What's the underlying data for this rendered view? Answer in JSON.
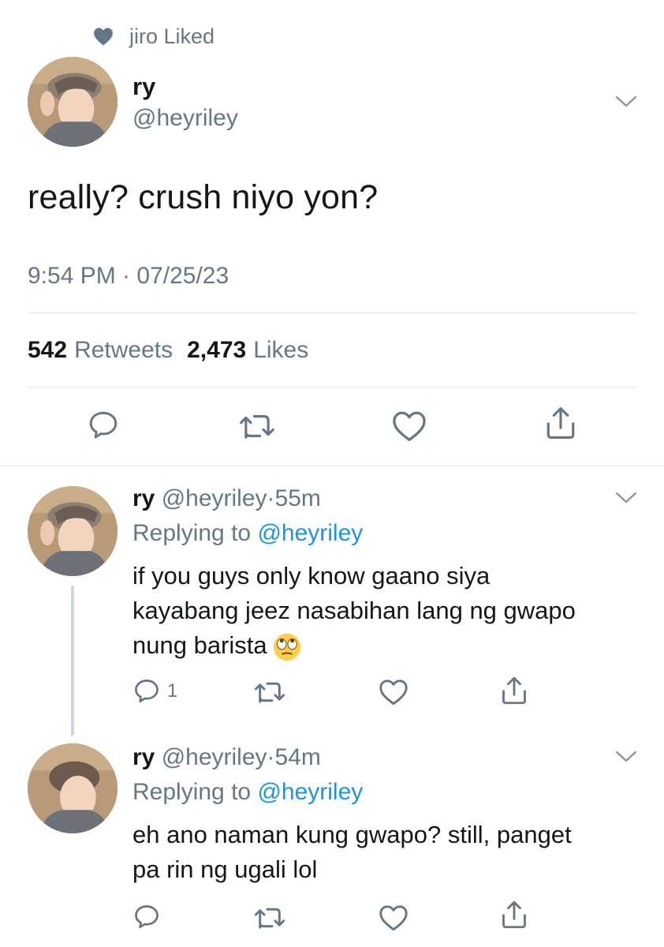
{
  "social_context": {
    "text": "jiro Liked",
    "icon": "heart-icon"
  },
  "main_tweet": {
    "name": "ry",
    "handle": "@heyriley",
    "text": "really? crush niyo yon?",
    "timestamp": "9:54 PM · 07/25/23",
    "retweets_count": "542",
    "retweets_label": "Retweets",
    "likes_count": "2,473",
    "likes_label": "Likes",
    "actions": [
      "reply-icon",
      "retweet-icon",
      "like-icon",
      "share-icon"
    ]
  },
  "replies": [
    {
      "name": "ry",
      "handle": "@heyriley",
      "separator": "·",
      "time": "55m",
      "replying_prefix": "Replying to",
      "replying_handle": "@heyriley",
      "lines": [
        "if you guys only know gaano siya",
        "kayabang jeez nasabihan lang ng gwapo",
        "nung barista"
      ],
      "emoji": "face-with-rolling-eyes",
      "reply_count": "1"
    },
    {
      "name": "ry",
      "handle": "@heyriley",
      "separator": "·",
      "time": "54m",
      "replying_prefix": "Replying to",
      "replying_handle": "@heyriley",
      "lines": [
        "eh ano naman kung gwapo? still, panget",
        "pa rin ng ugali lol"
      ]
    }
  ],
  "colors": {
    "text": "#14171a",
    "secondary": "#657786",
    "link": "#1b95e0",
    "divider": "#e1e8ed",
    "thread_line": "#ccd6dd"
  }
}
